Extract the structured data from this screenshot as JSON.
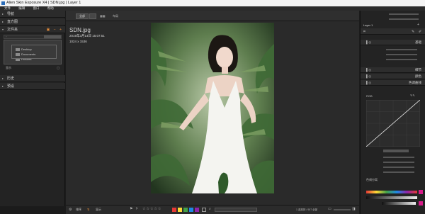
{
  "titlebar": {
    "title": "Alien Skin Exposure X4 | SDN.jpg | Layer 1"
  },
  "menubar": {
    "items": [
      "文件",
      "编辑",
      "窗口",
      "帮助"
    ]
  },
  "left_panel": {
    "sections": [
      "导航",
      "直方图",
      "文件夹",
      "历史",
      "预设"
    ],
    "folders": [
      "Desktop",
      "Documents",
      "Pictures"
    ],
    "search_placeholder": "",
    "footer_label": "显示"
  },
  "center": {
    "top_buttons": [
      "全部",
      "",
      "布局"
    ],
    "filename": "SDN.jpg",
    "date": "2019年3月14日 15:07:51",
    "dimensions": "1024 x 1536"
  },
  "bottom_bar": {
    "labels": [
      "排序",
      "显示",
      "",
      ""
    ],
    "status": "1 选择的 / 907 全部",
    "color_labels": [
      "#e53935",
      "#fdd835",
      "#43a047",
      "#1e88e5",
      "#8e24aa"
    ]
  },
  "right_panel": {
    "layer_name": "Layer 1",
    "top_sliders": [
      "",
      ""
    ],
    "sections": [
      "基础",
      "细节",
      "颜色",
      "色调曲线"
    ],
    "basic_sliders": [
      "",
      "",
      ""
    ],
    "curve_mode": "RGB",
    "curve_labels": [
      "",
      "",
      "",
      "",
      ""
    ],
    "color_adjust_label": "色调分离",
    "preset_select": "",
    "bottom_label": ""
  }
}
